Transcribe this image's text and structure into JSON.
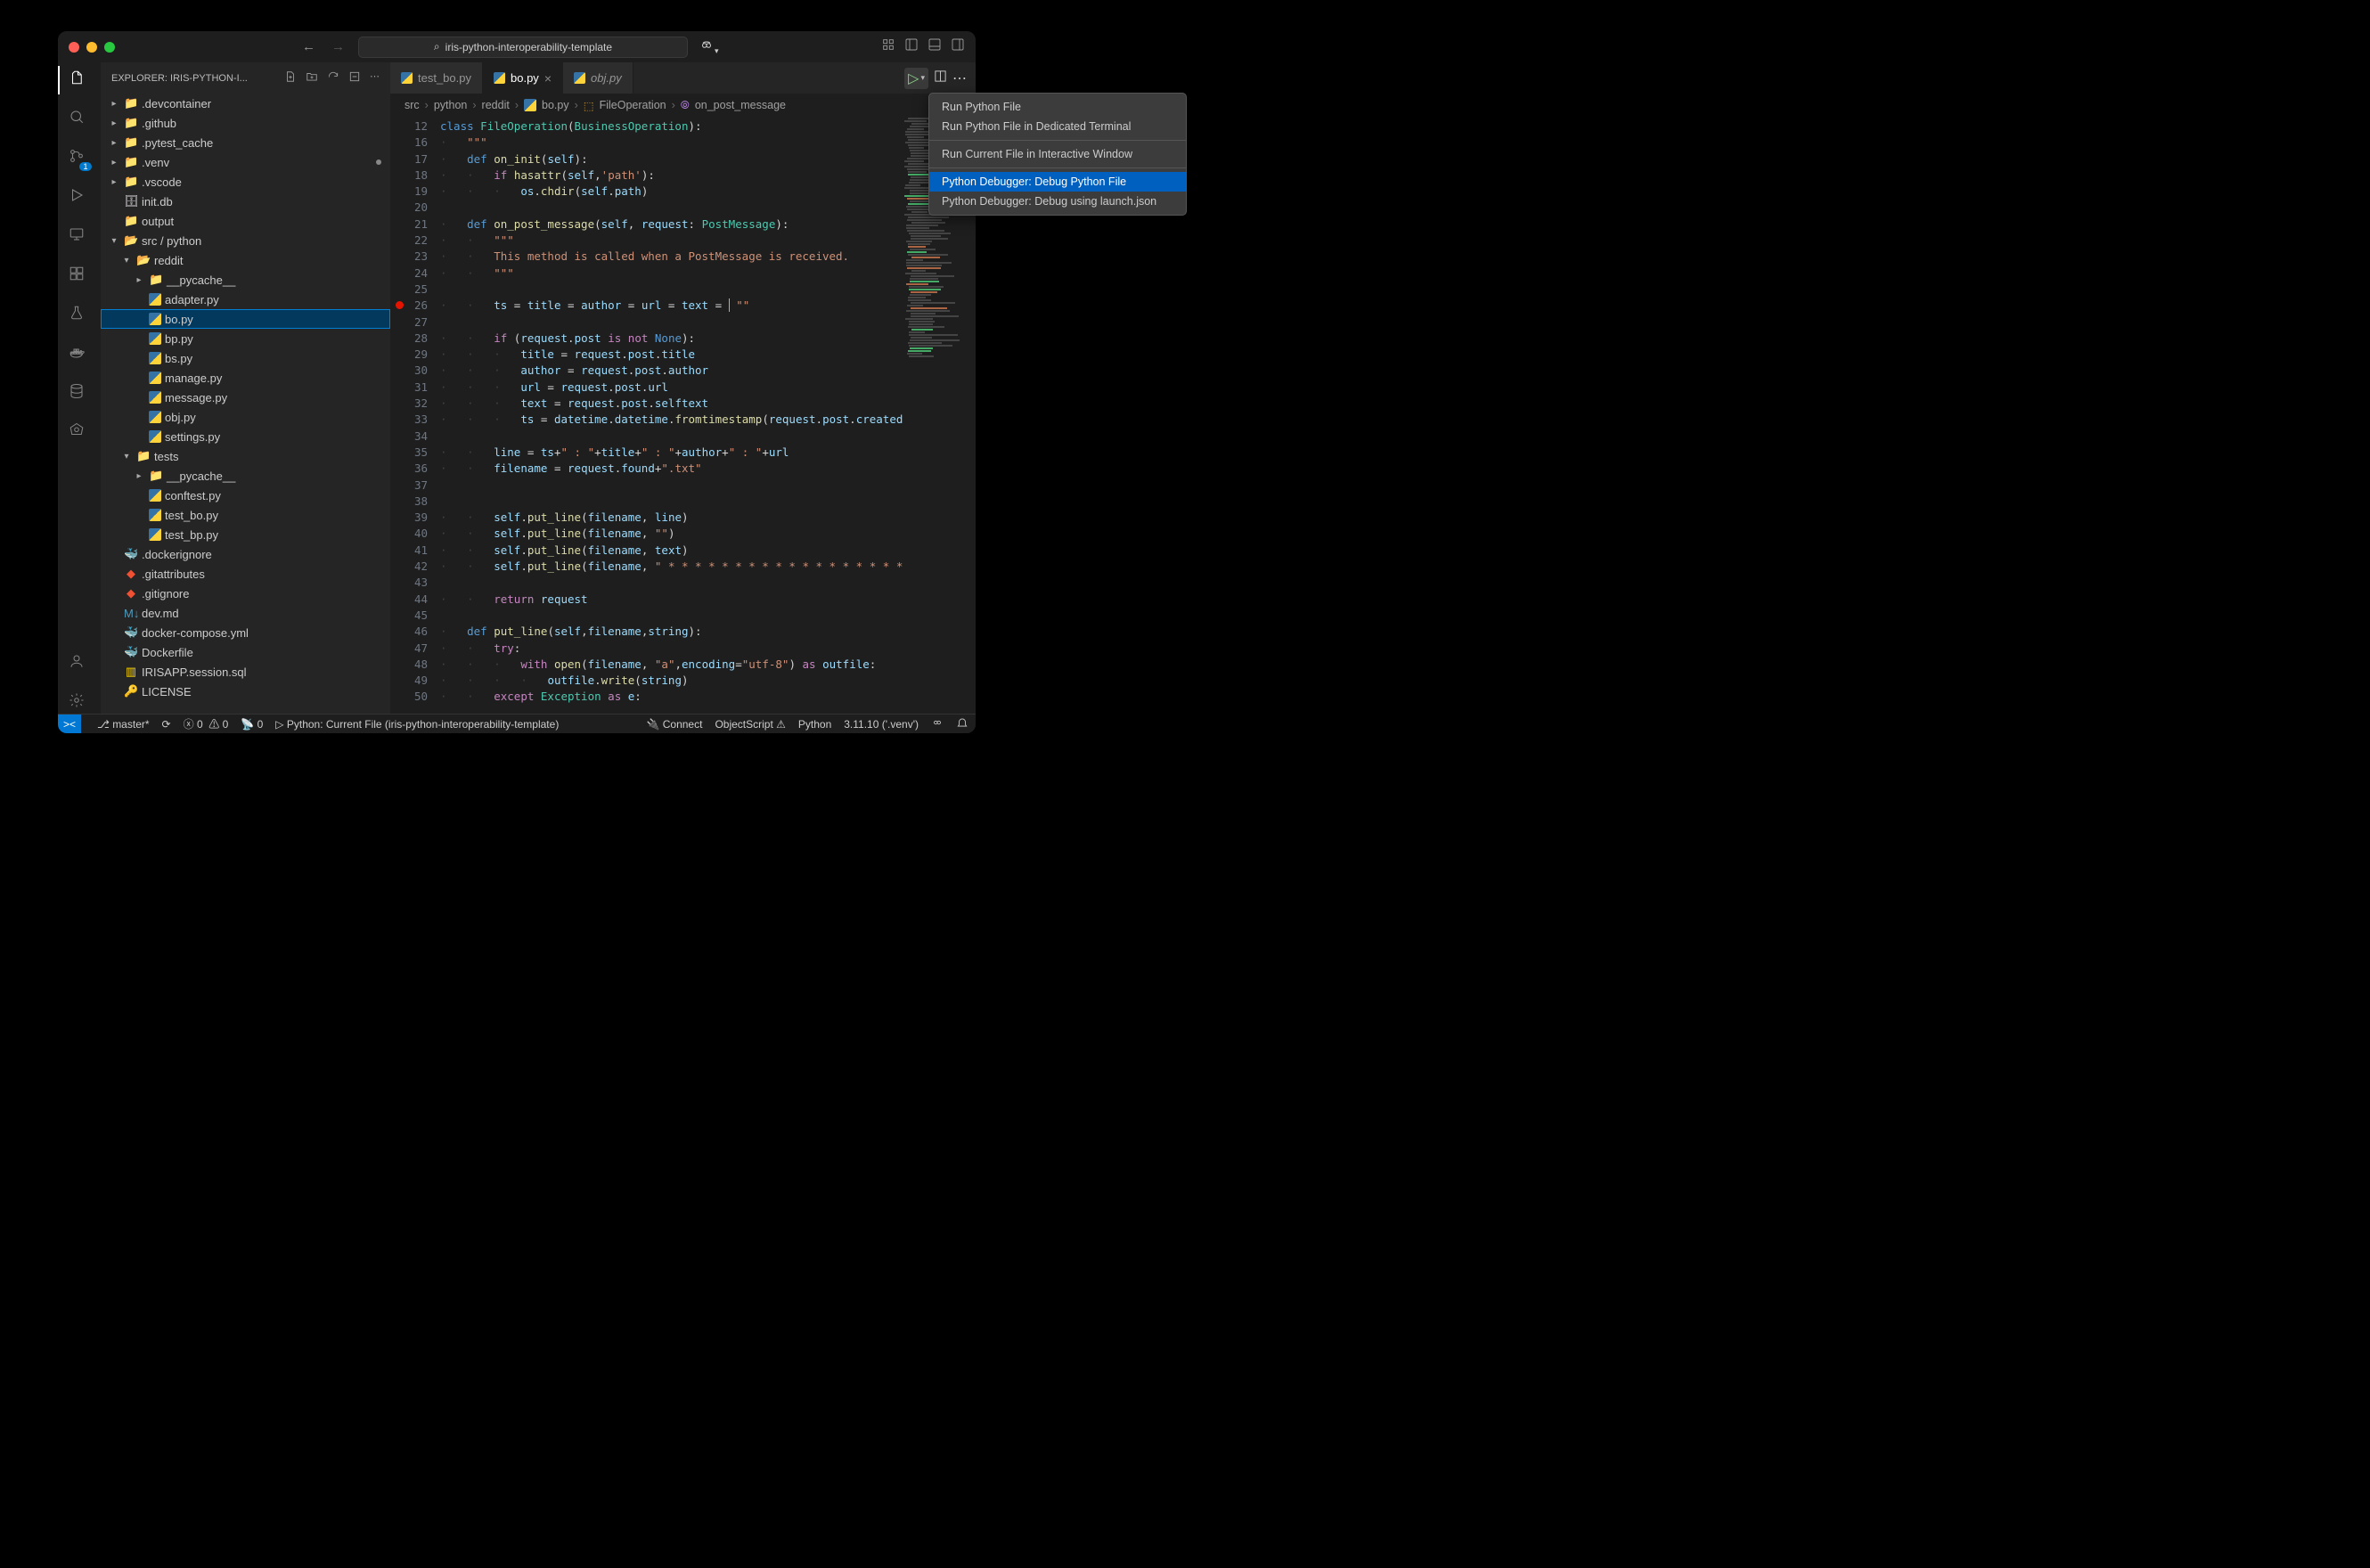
{
  "window": {
    "search_placeholder": "iris-python-interoperability-template"
  },
  "sidebar": {
    "title": "EXPLORER: IRIS-PYTHON-I...",
    "tree": [
      {
        "d": 0,
        "chev": "▸",
        "icon": "folder",
        "label": ".devcontainer"
      },
      {
        "d": 0,
        "chev": "▸",
        "icon": "folder",
        "label": ".github"
      },
      {
        "d": 0,
        "chev": "▸",
        "icon": "folder",
        "label": ".pytest_cache"
      },
      {
        "d": 0,
        "chev": "▸",
        "icon": "folder",
        "label": ".venv",
        "modified": true
      },
      {
        "d": 0,
        "chev": "▸",
        "icon": "folder",
        "label": ".vscode"
      },
      {
        "d": 0,
        "chev": "",
        "icon": "db",
        "label": "init.db"
      },
      {
        "d": 0,
        "chev": "",
        "icon": "folder",
        "label": "output"
      },
      {
        "d": 0,
        "chev": "▾",
        "icon": "folder-open",
        "label": "src / python"
      },
      {
        "d": 1,
        "chev": "▾",
        "icon": "folder-open",
        "label": "reddit"
      },
      {
        "d": 2,
        "chev": "▸",
        "icon": "folder-green",
        "label": "__pycache__"
      },
      {
        "d": 2,
        "chev": "",
        "icon": "py",
        "label": "adapter.py"
      },
      {
        "d": 2,
        "chev": "",
        "icon": "py",
        "label": "bo.py",
        "selected": true
      },
      {
        "d": 2,
        "chev": "",
        "icon": "py",
        "label": "bp.py"
      },
      {
        "d": 2,
        "chev": "",
        "icon": "py",
        "label": "bs.py"
      },
      {
        "d": 2,
        "chev": "",
        "icon": "py",
        "label": "manage.py"
      },
      {
        "d": 2,
        "chev": "",
        "icon": "py",
        "label": "message.py"
      },
      {
        "d": 2,
        "chev": "",
        "icon": "py",
        "label": "obj.py"
      },
      {
        "d": 2,
        "chev": "",
        "icon": "py",
        "label": "settings.py"
      },
      {
        "d": 1,
        "chev": "▾",
        "icon": "folder-green",
        "label": "tests"
      },
      {
        "d": 2,
        "chev": "▸",
        "icon": "folder-green",
        "label": "__pycache__"
      },
      {
        "d": 2,
        "chev": "",
        "icon": "py",
        "label": "conftest.py"
      },
      {
        "d": 2,
        "chev": "",
        "icon": "py",
        "label": "test_bo.py"
      },
      {
        "d": 2,
        "chev": "",
        "icon": "py",
        "label": "test_bp.py"
      },
      {
        "d": 0,
        "chev": "",
        "icon": "docker",
        "label": ".dockerignore"
      },
      {
        "d": 0,
        "chev": "",
        "icon": "git",
        "label": ".gitattributes"
      },
      {
        "d": 0,
        "chev": "",
        "icon": "git",
        "label": ".gitignore"
      },
      {
        "d": 0,
        "chev": "",
        "icon": "md",
        "label": "dev.md"
      },
      {
        "d": 0,
        "chev": "",
        "icon": "docker",
        "label": "docker-compose.yml"
      },
      {
        "d": 0,
        "chev": "",
        "icon": "docker",
        "label": "Dockerfile"
      },
      {
        "d": 0,
        "chev": "",
        "icon": "sql",
        "label": "IRISAPP.session.sql"
      },
      {
        "d": 0,
        "chev": "",
        "icon": "lic",
        "label": "LICENSE"
      }
    ]
  },
  "scm_badge": "1",
  "tabs": [
    {
      "label": "test_bo.py",
      "active": false
    },
    {
      "label": "bo.py",
      "active": true,
      "close": true
    },
    {
      "label": "obj.py",
      "active": false,
      "italic": true
    }
  ],
  "breadcrumbs": {
    "p1": "src",
    "p2": "python",
    "p3": "reddit",
    "p4": "bo.py",
    "p5": "FileOperation",
    "p6": "on_post_message"
  },
  "line_numbers": [
    "12",
    "16",
    "17",
    "18",
    "19",
    "20",
    "21",
    "22",
    "23",
    "24",
    "25",
    "26",
    "27",
    "28",
    "29",
    "30",
    "31",
    "32",
    "33",
    "34",
    "35",
    "36",
    "37",
    "38",
    "39",
    "40",
    "41",
    "42",
    "43",
    "44",
    "45",
    "46",
    "47",
    "48",
    "49",
    "50"
  ],
  "breakpoint_line": "26",
  "statusbar": {
    "branch": "master*",
    "sync": "",
    "errors": "0",
    "warnings": "0",
    "ports": "0",
    "debug": "Python: Current File (iris-python-interoperability-template)",
    "connect": "Connect",
    "objectscript": "ObjectScript",
    "lang": "Python",
    "interp": "3.11.10 ('.venv')"
  },
  "menu": {
    "i1": "Run Python File",
    "i2": "Run Python File in Dedicated Terminal",
    "i3": "Run Current File in Interactive Window",
    "i4": "Python Debugger: Debug Python File",
    "i5": "Python Debugger: Debug using launch.json"
  }
}
